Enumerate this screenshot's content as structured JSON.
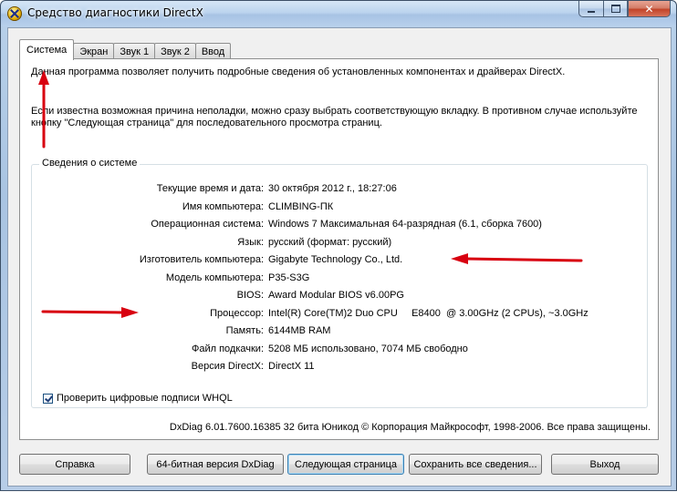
{
  "window": {
    "title": "Средство диагностики DirectX",
    "icon": "directx-x-icon"
  },
  "tabs": [
    {
      "label": "Система",
      "active": true
    },
    {
      "label": "Экран",
      "active": false
    },
    {
      "label": "Звук 1",
      "active": false
    },
    {
      "label": "Звук 2",
      "active": false
    },
    {
      "label": "Ввод",
      "active": false
    }
  ],
  "intro": {
    "line1": "Данная программа позволяет получить подробные сведения об установленных компонентах и драйверах DirectX.",
    "line2": "Если известна возможная причина неполадки, можно сразу выбрать соответствующую вкладку. В противном случае используйте кнопку \"Следующая страница\" для последовательного просмотра страниц."
  },
  "system_info": {
    "group_title": "Сведения о системе",
    "rows": [
      {
        "label": "Текущие время и дата:",
        "value": "30 октября 2012 г., 18:27:06"
      },
      {
        "label": "Имя компьютера:",
        "value": "CLIMBING-ПК"
      },
      {
        "label": "Операционная система:",
        "value": "Windows 7 Максимальная 64-разрядная (6.1, сборка 7600)"
      },
      {
        "label": "Язык:",
        "value": "русский (формат: русский)"
      },
      {
        "label": "Изготовитель компьютера:",
        "value": "Gigabyte Technology Co., Ltd."
      },
      {
        "label": "Модель компьютера:",
        "value": "P35-S3G"
      },
      {
        "label": "BIOS:",
        "value": "Award Modular BIOS v6.00PG"
      },
      {
        "label": "Процессор:",
        "value": "Intel(R) Core(TM)2 Duo CPU     E8400  @ 3.00GHz (2 CPUs), ~3.0GHz"
      },
      {
        "label": "Память:",
        "value": "6144MB RAM"
      },
      {
        "label": "Файл подкачки:",
        "value": "5208 МБ использовано, 7074 МБ свободно"
      },
      {
        "label": "Версия DirectX:",
        "value": "DirectX 11"
      }
    ],
    "whql_checkbox": {
      "label": "Проверить цифровые подписи WHQL",
      "checked": true
    }
  },
  "footer": {
    "copyright": "DxDiag 6.01.7600.16385 32 бита Юникод  © Корпорация Майкрософт, 1998-2006.  Все права защищены."
  },
  "buttons": {
    "help": "Справка",
    "dxdiag64": "64-битная версия DxDiag",
    "next_page": "Следующая страница",
    "save_all": "Сохранить все сведения...",
    "exit": "Выход"
  },
  "annotation_color": "#d80010"
}
